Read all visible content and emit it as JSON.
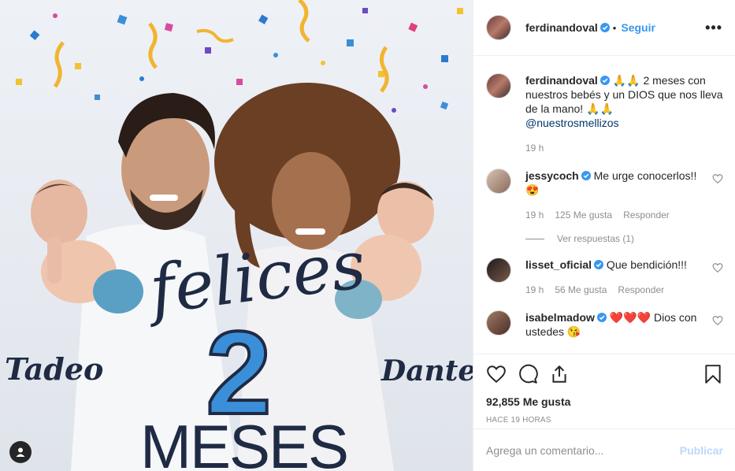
{
  "header": {
    "username": "ferdinandoval",
    "follow_label": "Seguir",
    "more_label": "•••"
  },
  "photo": {
    "name_left": "Tadeo",
    "name_right": "Dante",
    "headline": "felices",
    "number": "2",
    "unit": "MESES"
  },
  "caption": {
    "username": "ferdinandoval",
    "text": " 🙏🙏 2 meses con nuestros bebés y un DIOS que nos lleva de la mano! 🙏🙏",
    "mention": "@nuestrosmellizos",
    "time": "19 h"
  },
  "comments": [
    {
      "username": "jessycoch",
      "text": " Me urge conocerlos!! 😍",
      "time": "19 h",
      "likes": "125 Me gusta",
      "reply": "Responder",
      "view_replies": "Ver respuestas (1)"
    },
    {
      "username": "lisset_oficial",
      "text": " Que bendición!!!",
      "time": "19 h",
      "likes": "56 Me gusta",
      "reply": "Responder"
    },
    {
      "username": "isabelmadow",
      "text": " ❤️❤️❤️ Dios con ustedes 😘"
    }
  ],
  "actions": {
    "likes": "92,855 Me gusta",
    "posted_ago": "HACE 19 HORAS"
  },
  "add_comment": {
    "placeholder": "Agrega un comentario...",
    "publish_label": "Publicar"
  },
  "colors": {
    "accent": "#3897f0",
    "verified": "#3897f0",
    "muted": "#8e8e8e"
  }
}
